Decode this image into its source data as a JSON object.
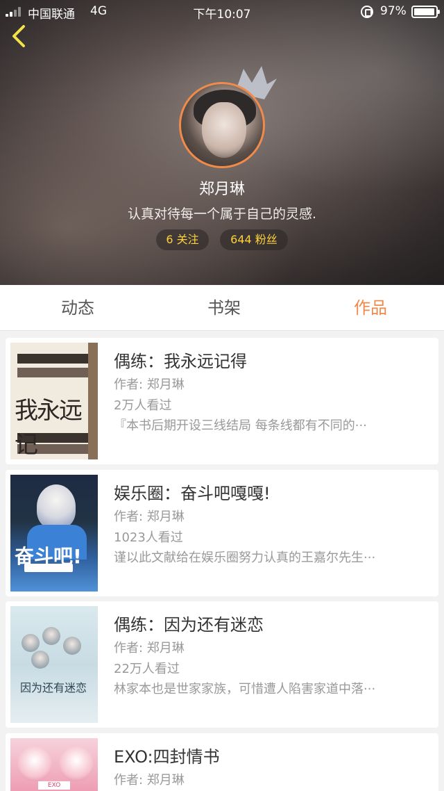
{
  "status_bar": {
    "carrier": "中国联通",
    "network": "4G",
    "time": "下午10:07",
    "battery": "97%"
  },
  "profile": {
    "name": "郑月琳",
    "bio": "认真对待每一个属于自己的灵感.",
    "following": "6 关注",
    "fans": "644 粉丝",
    "accent_color": "#f08b4b"
  },
  "tabs": [
    {
      "label": "动态",
      "active": false
    },
    {
      "label": "书架",
      "active": false
    },
    {
      "label": "作品",
      "active": true
    }
  ],
  "books": [
    {
      "title": "偶练：我永远记得",
      "author": "作者: 郑月琳",
      "views": "2万人看过",
      "desc": "『本书后期开设三线结局 每条线都有不同的···",
      "cover_text": "我永远记"
    },
    {
      "title": "娱乐圈：奋斗吧嘎嘎!",
      "author": "作者: 郑月琳",
      "views": "1023人看过",
      "desc": "谨以此文献给在娱乐圈努力认真的王嘉尔先生···",
      "cover_text": "奋斗吧!"
    },
    {
      "title": "偶练：因为还有迷恋",
      "author": "作者: 郑月琳",
      "views": "22万人看过",
      "desc": "林家本也是世家家族，可惜遭人陷害家道中落···",
      "cover_text": "因为还有迷恋"
    },
    {
      "title": "EXO:四封情书",
      "author": "作者: 郑月琳",
      "views": "",
      "desc": "",
      "cover_text": "EXO"
    }
  ]
}
